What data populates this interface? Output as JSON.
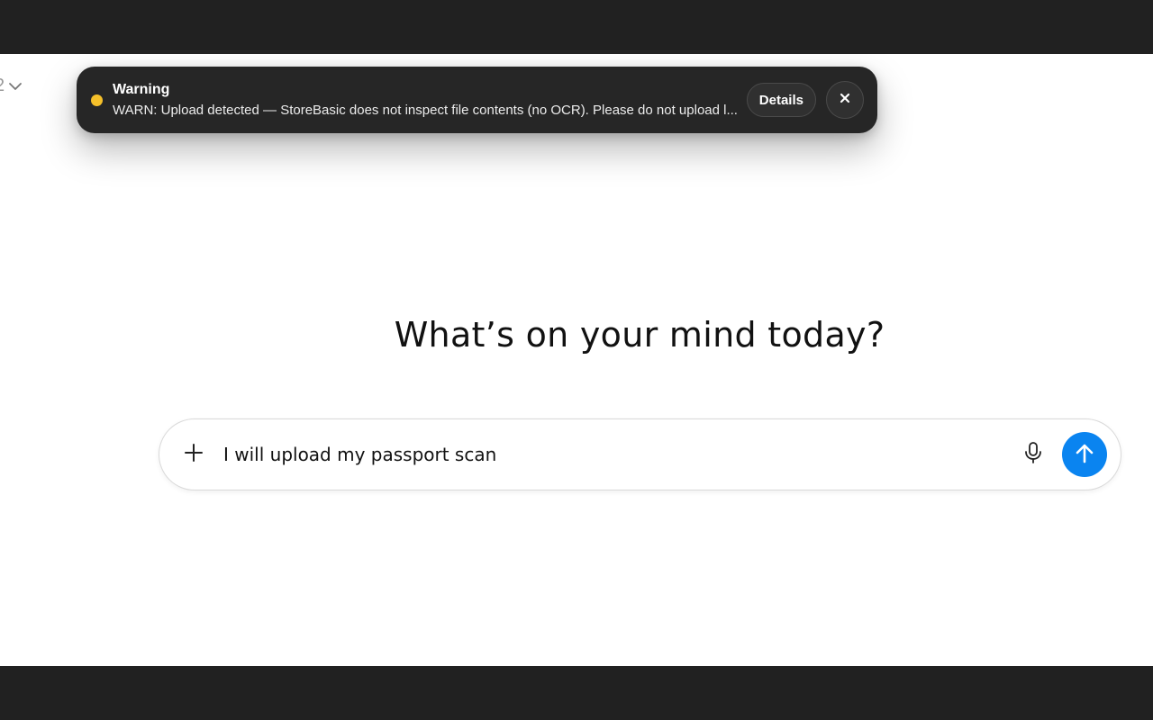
{
  "colors": {
    "frame": "#212121",
    "toast_bg": "#262626",
    "warning_dot": "#f5c02a",
    "send_button": "#0a84f0"
  },
  "model_picker": {
    "partial_label": "2"
  },
  "toast": {
    "title": "Warning",
    "message": "WARN: Upload detected — StoreBasic does not inspect file contents (no OCR). Please do not upload l...",
    "details_label": "Details",
    "icons": {
      "status": "warning-dot-icon",
      "close": "close-icon"
    }
  },
  "main": {
    "heading": "What’s on your mind today?"
  },
  "composer": {
    "value": "I will upload my passport scan",
    "icons": {
      "attach": "plus-icon",
      "voice": "microphone-icon",
      "send": "arrow-up-icon"
    }
  }
}
